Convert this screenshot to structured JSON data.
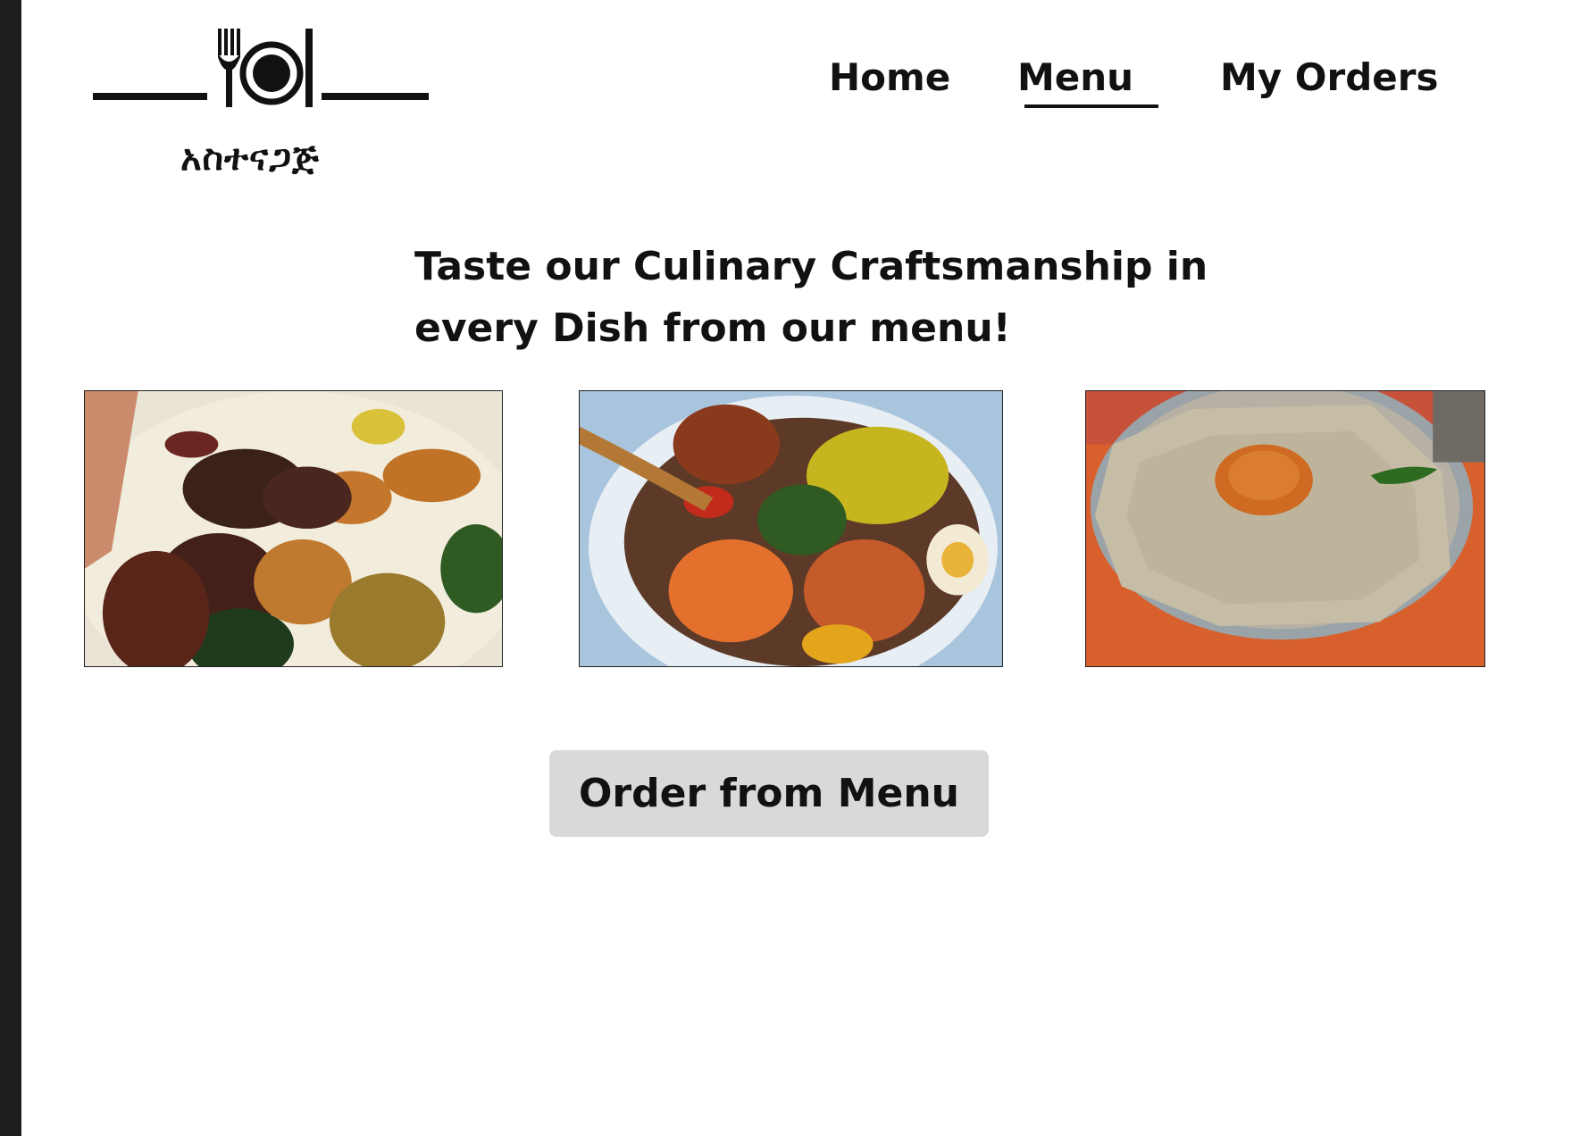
{
  "logo": {
    "amharic_text": "አስተናጋጅ",
    "icon": "fork-plate-knife-icon"
  },
  "nav": {
    "items": [
      {
        "label": "Home",
        "active": false
      },
      {
        "label": "Menu",
        "active": true
      },
      {
        "label": "My Orders",
        "active": false
      }
    ]
  },
  "main": {
    "headline_line1": "Taste our Culinary Craftsmanship in",
    "headline_line2": "every Dish from our menu!",
    "dishes": [
      {
        "name": "ethiopian-platter-image"
      },
      {
        "name": "injera-vegetable-plate-image"
      },
      {
        "name": "injera-shiro-plate-image"
      }
    ],
    "order_button_label": "Order from Menu"
  },
  "colors": {
    "sidebar": "#1e1e1e",
    "text": "#111111",
    "button_bg": "#d9d9d9",
    "page_bg": "#ffffff"
  }
}
